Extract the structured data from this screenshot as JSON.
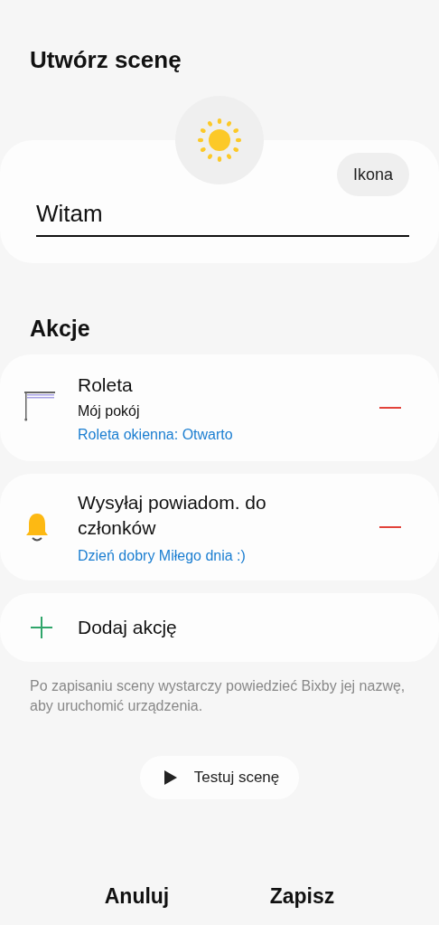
{
  "title": "Utwórz scenę",
  "scene": {
    "icon_button": "Ikona",
    "name": "Witam"
  },
  "actions_heading": "Akcje",
  "actions": [
    {
      "kind": "blind",
      "title": "Roleta",
      "subtitle": "Mój pokój",
      "detail": "Roleta okienna: Otwarto"
    },
    {
      "kind": "notification",
      "title": "Wysyłaj powiadom. do członków",
      "detail": "Dzień dobry Miłego dnia :)"
    }
  ],
  "add_action": "Dodaj akcję",
  "note": "Po zapisaniu sceny wystarczy powiedzieć Bixby jej nazwę, aby uruchomić urządzenia.",
  "test_button": "Testuj scenę",
  "footer": {
    "cancel": "Anuluj",
    "save": "Zapisz"
  }
}
